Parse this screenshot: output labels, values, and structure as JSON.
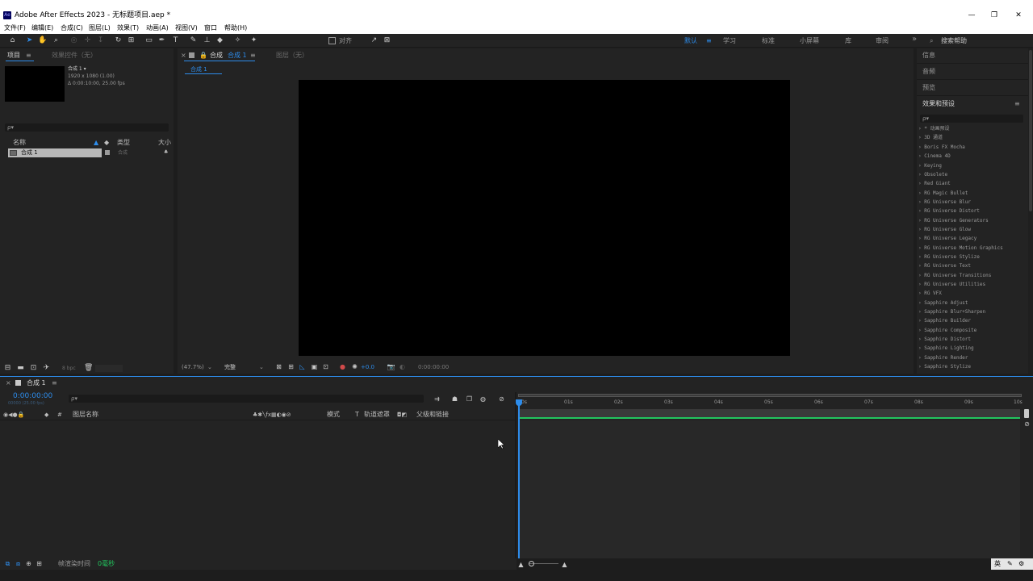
{
  "window": {
    "app_icon": "Ae",
    "title": "Adobe After Effects 2023 - 无标题项目.aep *",
    "minimize": "—",
    "restore": "❐",
    "close": "✕"
  },
  "menu": [
    "文件(F)",
    "编辑(E)",
    "合成(C)",
    "图层(L)",
    "效果(T)",
    "动画(A)",
    "视图(V)",
    "窗口",
    "帮助(H)"
  ],
  "toolbar": {
    "snap_label": "对齐",
    "workspaces": [
      "默认",
      "学习",
      "标准",
      "小屏幕",
      "库",
      "审阅"
    ],
    "more": "»",
    "search_help": "搜索帮助"
  },
  "project": {
    "tab": "项目",
    "tab_menu": "≡",
    "effects_tab": "效果控件（无）",
    "comp_name": "合成 1 ▾",
    "comp_res": "1920 x 1080 (1.00)",
    "comp_duration": "Δ 0:00:10:00, 25.00 fps",
    "search_icon": "ρ▾",
    "col_name": "名称",
    "col_type": "类型",
    "col_size": "大小",
    "item_name": "合成 1",
    "item_type": "合成",
    "bpc": "8 bpc"
  },
  "composition": {
    "close": "×",
    "tab": "合成",
    "tab_active": "合成 1",
    "tab_menu": "≡",
    "layer_tab": "图层（无）",
    "breadcrumb": "合成 1",
    "zoom": "(47.7%)",
    "quality": "完整",
    "exposure": "+0.0",
    "timecode": "0:00:00:00"
  },
  "right_panel": {
    "info": "信息",
    "audio": "音频",
    "preview": "预览",
    "effects_presets": "效果和预设",
    "fx_menu": "≡",
    "search_icon": "ρ▾",
    "effects": [
      "› * 动画预设",
      "› 3D 通道",
      "› Boris FX Mocha",
      "› Cinema 4D",
      "› Keying",
      "› Obsolete",
      "› Red Giant",
      "› RG Magic Bullet",
      "› RG Universe Blur",
      "› RG Universe Distort",
      "› RG Universe Generators",
      "› RG Universe Glow",
      "› RG Universe Legacy",
      "› RG Universe Motion Graphics",
      "› RG Universe Stylize",
      "› RG Universe Text",
      "› RG Universe Transitions",
      "› RG Universe Utilities",
      "› RG VFX",
      "› Sapphire Adjust",
      "› Sapphire Blur+Sharpen",
      "› Sapphire Builder",
      "› Sapphire Composite",
      "› Sapphire Distort",
      "› Sapphire Lighting",
      "› Sapphire Render",
      "› Sapphire Stylize"
    ]
  },
  "timeline": {
    "close": "×",
    "tab": "合成 1",
    "tab_menu": "≡",
    "timecode": "0:00:00:00",
    "fps_sub": "00000 (25.00 fps)",
    "search_icon": "ρ▾",
    "col_layer_name": "图层名称",
    "col_mode": "模式",
    "col_t": "T",
    "col_track_matte": "轨道遮罩",
    "col_parent": "父级和链接",
    "ruler": [
      "0s",
      "01s",
      "02s",
      "03s",
      "04s",
      "05s",
      "06s",
      "07s",
      "08s",
      "09s",
      "10s"
    ],
    "render_time_label": "帧渲染时间",
    "render_time_value": "0毫秒"
  },
  "taskbar": {
    "ime": "英"
  },
  "colors": {
    "accent": "#2d8ceb",
    "work_area": "#22c55e"
  }
}
